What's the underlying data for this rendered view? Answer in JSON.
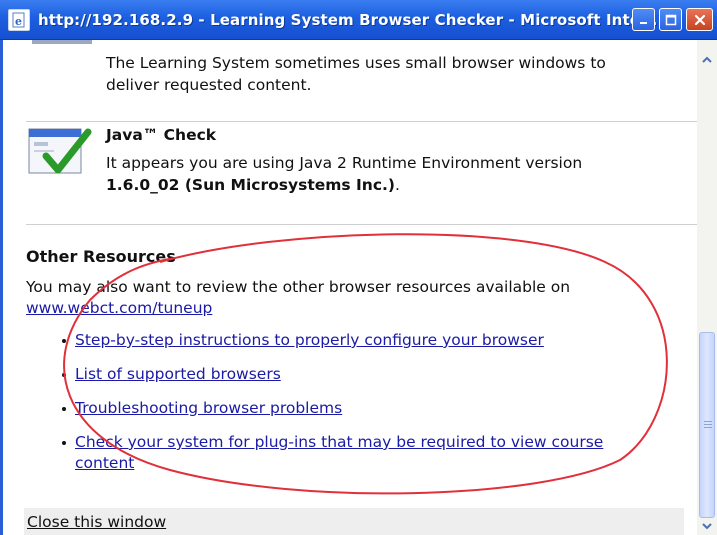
{
  "window": {
    "title": "http://192.168.2.9 - Learning System Browser Checker - Microsoft Inte..."
  },
  "popup_section": {
    "text_line1": "The Learning System sometimes uses small browser windows to",
    "text_line2": "deliver requested content."
  },
  "java_check": {
    "heading": "Java™ Check",
    "text_line1": "It appears you are using Java 2 Runtime Environment version",
    "version": "1.6.0_02 (Sun Microsystems Inc.)",
    "period": "."
  },
  "other_resources": {
    "heading": "Other Resources",
    "intro": "You may also want to review the other browser resources available on",
    "url": "www.webct.com/tuneup",
    "links": [
      {
        "label": "Step-by-step instructions to properly configure your browser"
      },
      {
        "label": "List of supported browsers"
      },
      {
        "label": "Troubleshooting browser problems"
      },
      {
        "label_line1": "Check your system for plug-ins that may be required to view course",
        "label_line2": "content"
      }
    ]
  },
  "footer": {
    "close_label": "Close this window"
  },
  "colors": {
    "titlebar": "#1c5fe0",
    "link": "#1a1aa6",
    "annotation": "#e0303a",
    "checkmark": "#2a9a2a"
  },
  "icons": [
    "ie-page-icon",
    "minimize-icon",
    "maximize-icon",
    "close-icon",
    "java-check-icon",
    "scroll-up-icon",
    "scroll-down-icon"
  ]
}
